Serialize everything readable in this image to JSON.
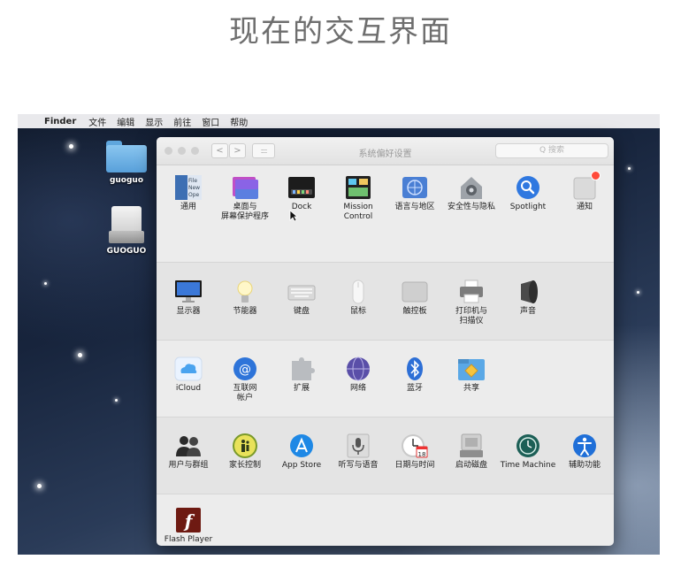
{
  "slide_title": "现在的交互界面",
  "menubar": {
    "apple_icon": "",
    "items": [
      "Finder",
      "文件",
      "编辑",
      "显示",
      "前往",
      "窗口",
      "帮助"
    ]
  },
  "desktop": {
    "folder_label": "guoguo",
    "drive_label": "GUOGUO"
  },
  "window": {
    "title": "系统偏好设置",
    "back_label": "<",
    "forward_label": ">",
    "grid_label": "::::",
    "search_placeholder": "Q 搜索",
    "rows": [
      [
        {
          "label": "通用",
          "icon": "general-icon"
        },
        {
          "label": "桌面与\n屏幕保护程序",
          "icon": "desktop-screensaver-icon"
        },
        {
          "label": "Dock",
          "icon": "dock-icon"
        },
        {
          "label": "Mission\nControl",
          "icon": "mission-control-icon"
        },
        {
          "label": "语言与地区",
          "icon": "language-region-icon"
        },
        {
          "label": "安全性与隐私",
          "icon": "security-privacy-icon"
        },
        {
          "label": "Spotlight",
          "icon": "spotlight-icon"
        },
        {
          "label": "通知",
          "icon": "notifications-icon"
        }
      ],
      [
        {
          "label": "显示器",
          "icon": "displays-icon"
        },
        {
          "label": "节能器",
          "icon": "energy-saver-icon"
        },
        {
          "label": "键盘",
          "icon": "keyboard-icon"
        },
        {
          "label": "鼠标",
          "icon": "mouse-icon"
        },
        {
          "label": "触控板",
          "icon": "trackpad-icon"
        },
        {
          "label": "打印机与\n扫描仪",
          "icon": "printers-scanners-icon"
        },
        {
          "label": "声音",
          "icon": "sound-icon"
        }
      ],
      [
        {
          "label": "iCloud",
          "icon": "icloud-icon"
        },
        {
          "label": "互联网\n帐户",
          "icon": "internet-accounts-icon"
        },
        {
          "label": "扩展",
          "icon": "extensions-icon"
        },
        {
          "label": "网络",
          "icon": "network-icon"
        },
        {
          "label": "蓝牙",
          "icon": "bluetooth-icon"
        },
        {
          "label": "共享",
          "icon": "sharing-icon"
        }
      ],
      [
        {
          "label": "用户与群组",
          "icon": "users-groups-icon"
        },
        {
          "label": "家长控制",
          "icon": "parental-controls-icon"
        },
        {
          "label": "App Store",
          "icon": "app-store-icon"
        },
        {
          "label": "听写与语音",
          "icon": "dictation-speech-icon"
        },
        {
          "label": "日期与时间",
          "icon": "date-time-icon"
        },
        {
          "label": "启动磁盘",
          "icon": "startup-disk-icon"
        },
        {
          "label": "Time Machine",
          "icon": "time-machine-icon"
        },
        {
          "label": "辅助功能",
          "icon": "accessibility-icon"
        }
      ],
      [
        {
          "label": "Flash Player",
          "icon": "flash-player-icon"
        }
      ]
    ],
    "general_icon_text": "File\nNew\nOpe",
    "calendar_day": "18",
    "flash_glyph": "f"
  },
  "colors": {
    "accent": "#1d7fe8",
    "badge": "#ff4a3a",
    "window_bg": "#ececec"
  }
}
